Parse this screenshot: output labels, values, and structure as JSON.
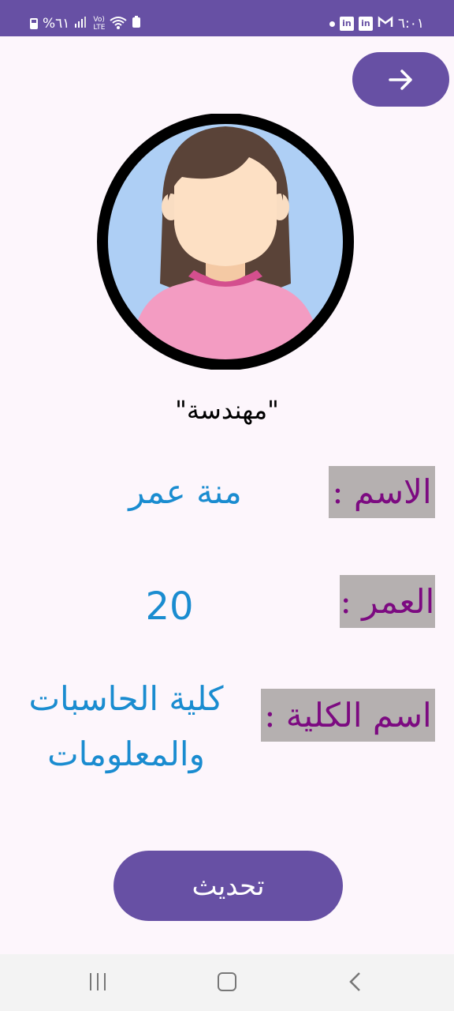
{
  "status_bar": {
    "time": "٦:٠١",
    "battery": "%٦١",
    "signal_icons": [
      "battery-icon",
      "signal-icon",
      "volte-icon",
      "wifi-icon",
      "data-saver-icon"
    ],
    "notification_icons": [
      "dot-icon",
      "linkedin-icon",
      "linkedin-icon",
      "gmail-icon"
    ]
  },
  "header": {
    "back_icon": "arrow-right-icon"
  },
  "profile": {
    "avatar_icon": "female-avatar-icon",
    "title": "\"مهندسة\"",
    "name_label": "الاسم :",
    "name_value": "منة عمر",
    "age_label": "العمر :",
    "age_value": "20",
    "college_label": "اسم الكلية :",
    "college_value_line1": "كلية الحاسبات",
    "college_value_line2": "والمعلومات"
  },
  "actions": {
    "update_label": "تحديث"
  },
  "nav": {
    "recent_icon": "recent-apps-icon",
    "home_icon": "home-icon",
    "back_icon": "back-chevron-icon"
  },
  "colors": {
    "primary": "#6750a4",
    "label_bg": "#b5b0b0",
    "label_text": "#7c0a81",
    "value_text": "#1a8cd0",
    "background": "#fdf6fc"
  }
}
